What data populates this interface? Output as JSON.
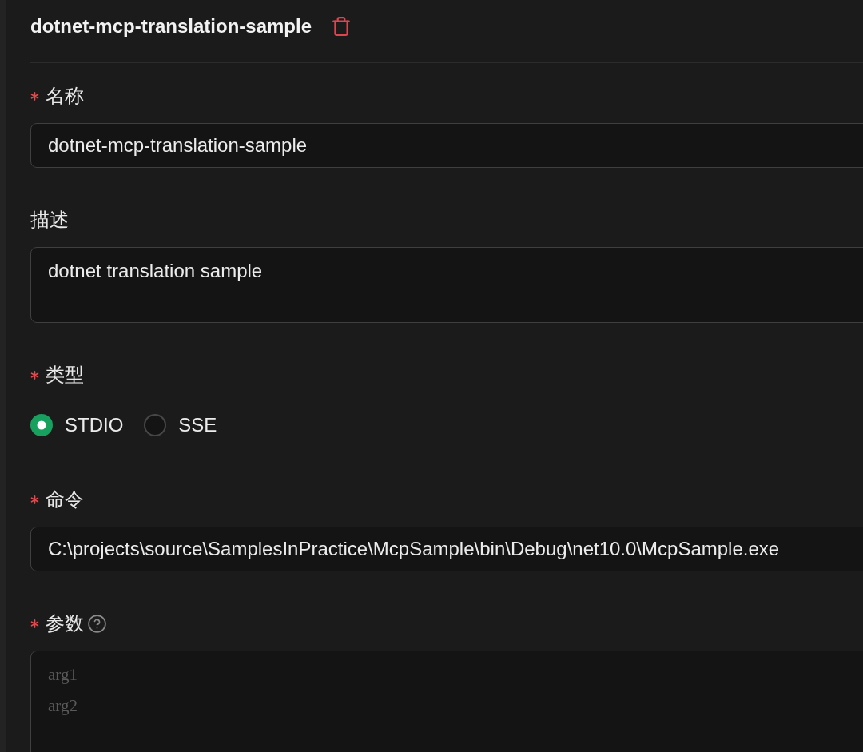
{
  "header": {
    "title": "dotnet-mcp-translation-sample"
  },
  "fields": [
    {
      "kind": "input",
      "label": "名称",
      "required": true,
      "help": false,
      "value": "dotnet-mcp-translation-sample"
    },
    {
      "kind": "textarea",
      "label": "描述",
      "required": false,
      "help": false,
      "value": "dotnet translation sample"
    },
    {
      "kind": "radio",
      "label": "类型",
      "required": true,
      "help": false,
      "options": [
        {
          "label": "STDIO",
          "selected": true
        },
        {
          "label": "SSE",
          "selected": false
        }
      ]
    },
    {
      "kind": "input",
      "label": "命令",
      "required": true,
      "help": false,
      "value": "C:\\projects\\source\\SamplesInPractice\\McpSample\\bin\\Debug\\net10.0\\McpSample.exe"
    },
    {
      "kind": "textarea",
      "label": "参数",
      "required": true,
      "help": true,
      "placeholder": "arg1\narg2"
    }
  ]
}
